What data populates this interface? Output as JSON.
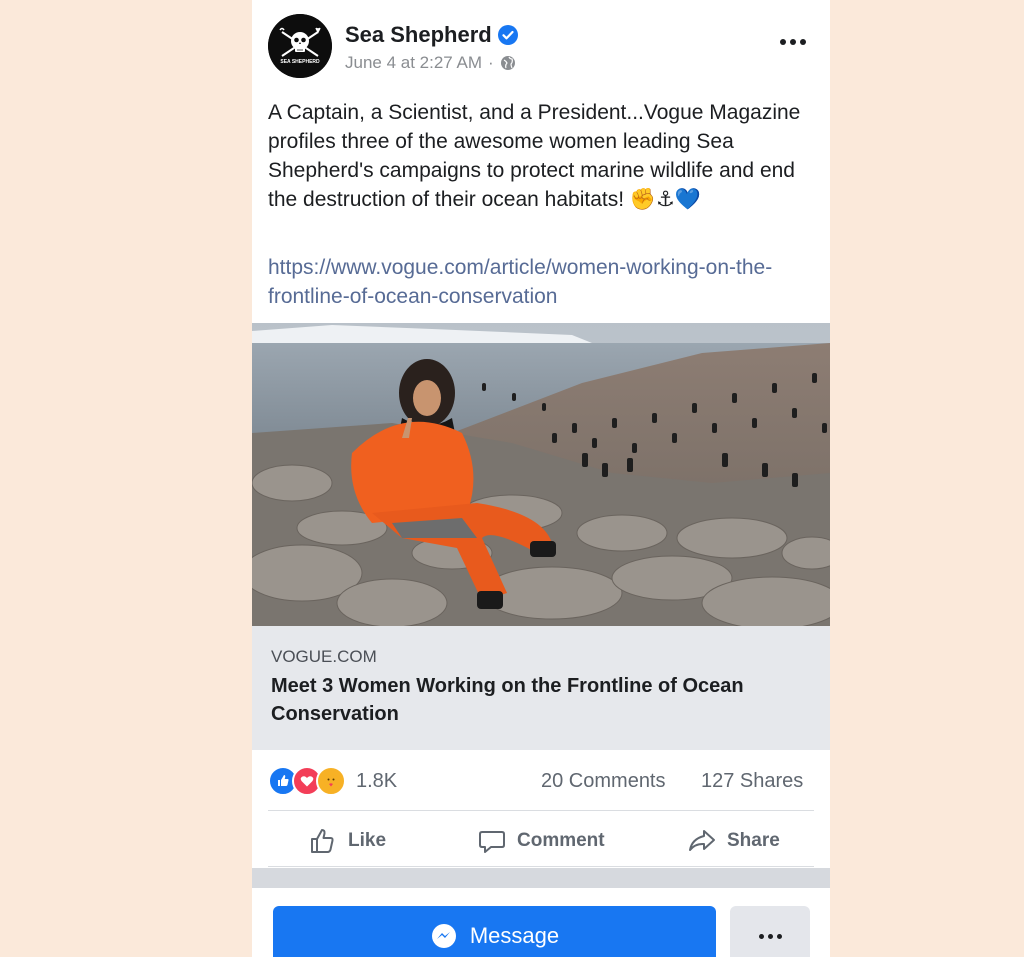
{
  "post": {
    "page_name": "Sea Shepherd",
    "timestamp": "June 4 at 2:27 AM",
    "meta_separator": "·",
    "avatar_text": "SEA SHEPHERD",
    "text": "A Captain, a Scientist, and a President...Vogue Magazine profiles three of the awesome women leading Sea Shepherd's campaigns to protect marine wildlife and end the destruction of their ocean habitats! ✊⚓💙",
    "link": "https://www.vogue.com/article/women-working-on-the-frontline-of-ocean-conservation"
  },
  "preview": {
    "domain": "VOGUE.COM",
    "headline": "Meet 3 Women Working on the Frontline of Ocean Conservation"
  },
  "stats": {
    "reactions": "1.8K",
    "comments": "20 Comments",
    "shares": "127 Shares",
    "reaction_icons": [
      "like-icon",
      "love-icon",
      "care-icon"
    ]
  },
  "actions": {
    "like": "Like",
    "comment": "Comment",
    "share": "Share"
  },
  "bottom": {
    "message": "Message"
  },
  "colors": {
    "page_background": "#fbe9da",
    "link": "#576b95",
    "accent": "#1877f2",
    "preview_background": "#e6e8ec"
  }
}
